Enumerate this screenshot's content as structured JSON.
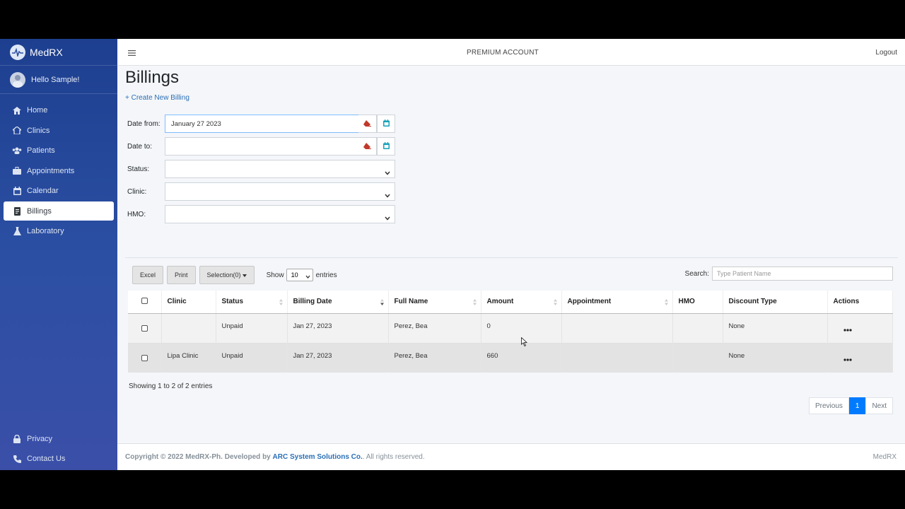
{
  "brand": {
    "name": "MedRX",
    "logo_icon": "pulse-logo-icon"
  },
  "user": {
    "greeting": "Hello Sample!"
  },
  "sidebar": {
    "items": [
      {
        "label": "Home",
        "icon": "home-icon"
      },
      {
        "label": "Clinics",
        "icon": "clinic-icon"
      },
      {
        "label": "Patients",
        "icon": "users-icon"
      },
      {
        "label": "Appointments",
        "icon": "briefcase-icon"
      },
      {
        "label": "Calendar",
        "icon": "calendar-icon"
      },
      {
        "label": "Billings",
        "icon": "receipt-icon",
        "active": true
      },
      {
        "label": "Laboratory",
        "icon": "flask-icon"
      }
    ],
    "bottom_items": [
      {
        "label": "Privacy",
        "icon": "lock-icon"
      },
      {
        "label": "Contact Us",
        "icon": "phone-icon"
      }
    ]
  },
  "topbar": {
    "account_type": "PREMIUM ACCOUNT",
    "logout": "Logout"
  },
  "page": {
    "title": "Billings",
    "create_link": "+ Create New Billing"
  },
  "filters": {
    "date_from": {
      "label": "Date from:",
      "value": "January 27 2023"
    },
    "date_to": {
      "label": "Date to:",
      "value": ""
    },
    "status": {
      "label": "Status:",
      "value": ""
    },
    "clinic": {
      "label": "Clinic:",
      "value": ""
    },
    "hmo": {
      "label": "HMO:",
      "value": ""
    }
  },
  "toolbar": {
    "excel": "Excel",
    "print": "Print",
    "selection": "Selection(0)",
    "show_label": "Show",
    "show_value": "10",
    "entries_label": "entries",
    "search_label": "Search:",
    "search_placeholder": "Type Patient Name"
  },
  "table": {
    "columns": [
      "Clinic",
      "Status",
      "Billing Date",
      "Full Name",
      "Amount",
      "Appointment",
      "HMO",
      "Discount Type",
      "Actions"
    ],
    "rows": [
      {
        "clinic": "",
        "status": "Unpaid",
        "billing_date": "Jan 27, 2023",
        "full_name": "Perez, Bea",
        "amount": "0",
        "appointment": "",
        "hmo": "",
        "discount_type": "None"
      },
      {
        "clinic": "Lipa Clinic",
        "status": "Unpaid",
        "billing_date": "Jan 27, 2023",
        "full_name": "Perez, Bea",
        "amount": "660",
        "appointment": "",
        "hmo": "",
        "discount_type": "None"
      }
    ]
  },
  "pagination": {
    "info": "Showing 1 to 2 of 2 entries",
    "previous": "Previous",
    "current": "1",
    "next": "Next"
  },
  "footer": {
    "copyright_prefix": "Copyright © 2022 MedRX-Ph. Developed by",
    "company": "ARC System Solutions Co.",
    "suffix": ". All rights reserved.",
    "brand": "MedRX"
  },
  "colors": {
    "sidebar": "#2b4fa3",
    "accent": "#007bff",
    "link": "#2a6fb6",
    "danger": "#c0392b",
    "teal": "#17a2b8"
  }
}
